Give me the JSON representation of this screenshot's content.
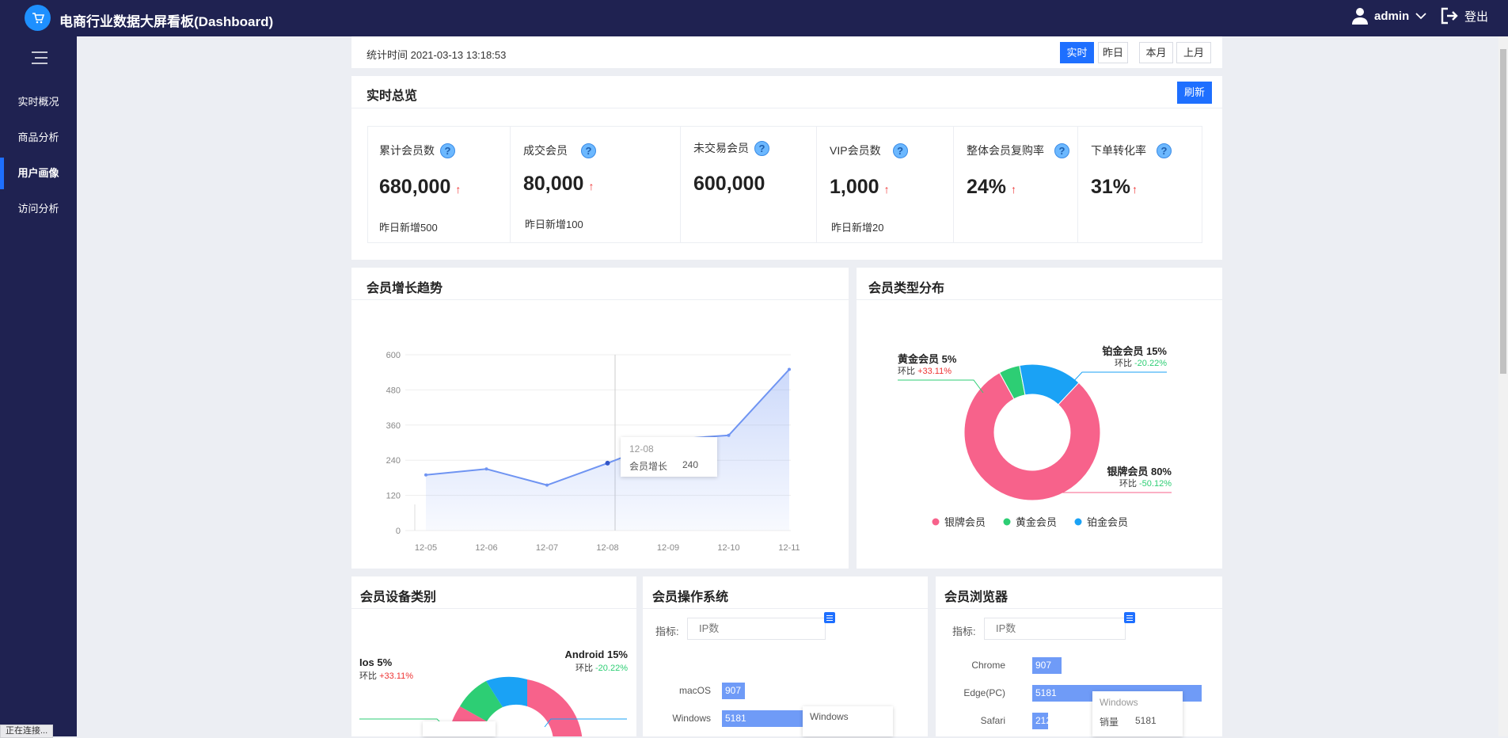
{
  "app": {
    "title": "电商行业数据大屏看板(Dashboard)"
  },
  "header": {
    "user": "admin",
    "logout": "登出"
  },
  "sidebar": {
    "items": [
      {
        "label": "实时概况"
      },
      {
        "label": "商品分析"
      },
      {
        "label": "用户画像",
        "active": true
      },
      {
        "label": "访问分析"
      }
    ]
  },
  "toolbar": {
    "stat_time": "统计时间 2021-03-13 13:18:53",
    "ranges": [
      "实时",
      "昨日",
      "本月",
      "上月"
    ],
    "active_range": "实时"
  },
  "overview": {
    "title": "实时总览",
    "refresh": "刷新",
    "kpis": [
      {
        "label": "累计会员数",
        "value": "680,000",
        "up": true,
        "sub": "昨日新增500"
      },
      {
        "label": "成交会员",
        "value": "80,000",
        "up": true,
        "sub": "昨日新增100"
      },
      {
        "label": "未交易会员",
        "value": "600,000",
        "up": false,
        "sub": ""
      },
      {
        "label": "VIP会员数",
        "value": "1,000",
        "up": true,
        "sub": "昨日新增20"
      },
      {
        "label": "整体会员复购率",
        "value": "24%",
        "up": true,
        "sub": ""
      },
      {
        "label": "下单转化率",
        "value": "31%",
        "up": true,
        "sub": ""
      }
    ],
    "up_arrow": "↑",
    "help": "?"
  },
  "growth": {
    "title": "会员增长趋势",
    "tooltip": {
      "date": "12-08",
      "label": "会员增长",
      "value": "240"
    },
    "chart_data": {
      "type": "line",
      "categories": [
        "12-05",
        "12-06",
        "12-07",
        "12-08",
        "12-09",
        "12-10",
        "12-11"
      ],
      "values": [
        190,
        210,
        155,
        230,
        310,
        325,
        550
      ],
      "y_ticks": [
        "0",
        "120",
        "240",
        "360",
        "480",
        "600"
      ],
      "ylim": [
        0,
        600
      ],
      "area": true,
      "color": "#6f94f2"
    }
  },
  "member_types": {
    "title": "会员类型分布",
    "chart_data": {
      "type": "pie",
      "donut": true,
      "slices": [
        {
          "name": "银牌会员",
          "value": 80,
          "label": "银牌会员 80%",
          "change_prefix": "环比",
          "change": "-50.12%",
          "color": "#f7628b"
        },
        {
          "name": "黄金会员",
          "value": 5,
          "label": "黄金会员 5%",
          "change_prefix": "环比",
          "change": "+33.11%",
          "color": "#2dce74"
        },
        {
          "name": "铂金会员",
          "value": 15,
          "label": "铂金会员 15%",
          "change_prefix": "环比",
          "change": "-20.22%",
          "color": "#1aa2f5"
        }
      ],
      "legend": [
        "银牌会员",
        "黄金会员",
        "铂金会员"
      ],
      "legend_position": "bottom"
    }
  },
  "devices": {
    "title": "会员设备类别",
    "labels": [
      {
        "name": "Ios 5%",
        "change_prefix": "环比",
        "change": "+33.11%"
      },
      {
        "name": "Android 15%",
        "change_prefix": "环比",
        "change": "-20.22%"
      }
    ],
    "colors": [
      "#f7628b",
      "#2dce74",
      "#1aa2f5"
    ]
  },
  "os": {
    "title": "会员操作系统",
    "metric_label": "指标:",
    "metric_value": "IP数",
    "chart_data": {
      "type": "bar",
      "categories": [
        "macOS",
        "Windows"
      ],
      "values": [
        907,
        5181
      ]
    },
    "tooltip": {
      "title": "Windows"
    }
  },
  "browser": {
    "title": "会员浏览器",
    "metric_label": "指标:",
    "metric_value": "IP数",
    "chart_data": {
      "type": "bar",
      "categories": [
        "Chrome",
        "Edge(PC)",
        "Safari"
      ],
      "values": [
        907,
        5181,
        212
      ]
    },
    "tooltip": {
      "title": "Windows",
      "label": "销量",
      "value": "5181"
    }
  },
  "status_bar": {
    "text": "正在连接..."
  }
}
